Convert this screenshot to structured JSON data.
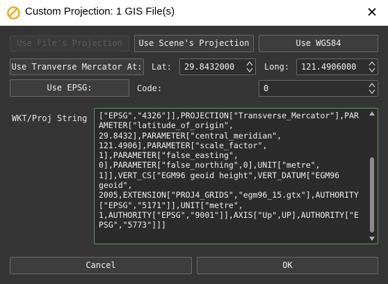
{
  "window": {
    "title": "Custom Projection: 1 GIS File(s)",
    "close_glyph": "✕"
  },
  "buttons": {
    "use_files_projection": "Use File's Projection",
    "use_scenes_projection": "Use Scene's Projection",
    "use_wgs84": "Use WGS84",
    "use_transverse_mercator": "Use Tranverse Mercator At:",
    "use_epsg": "Use EPSG:",
    "cancel": "Cancel",
    "ok": "OK"
  },
  "fields": {
    "lat_label": "Lat:",
    "lat_value": "29.8432000",
    "long_label": "Long:",
    "long_value": "121.4906000",
    "code_label": "Code:",
    "code_value": "0",
    "wkt_label": "WKT/Proj String"
  },
  "wkt_text": "[\"EPSG\",\"4326\"]],PROJECTION[\"Transverse_Mercator\"],PAR\nAMETER[\"latitude_of_origin\",\n29.8432],PARAMETER[\"central_meridian\",\n121.4906],PARAMETER[\"scale_factor\",\n1],PARAMETER[\"false_easting\",\n0],PARAMETER[\"false_northing\",0],UNIT[\"metre\",\n1]],VERT_CS[\"EGM96 geoid height\",VERT_DATUM[\"EGM96\ngeoid\",\n2005,EXTENSION[\"PROJ4_GRIDS\",\"egm96_15.gtx\"],AUTHORITY\n[\"EPSG\",\"5171\"]],UNIT[\"metre\",\n1,AUTHORITY[\"EPSG\",\"9001\"]],AXIS[\"Up\",UP],AUTHORITY[\"E\nPSG\",\"5773\"]]]",
  "icons": {
    "app": "app-logo-icon",
    "close": "close-icon",
    "spin_arrows": "spin-arrows-icon"
  },
  "colors": {
    "background": "#353535",
    "titlebar": "#ffffff",
    "focus_border": "#4aa35a",
    "logo": "#f0a818"
  }
}
